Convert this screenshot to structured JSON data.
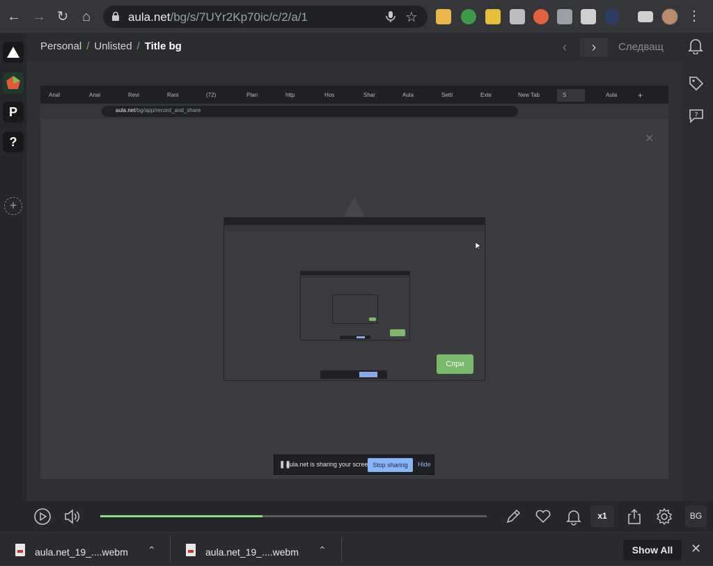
{
  "browser": {
    "url_host": "aula.net",
    "url_path": "/bg/s/7UYr2Kp70ic/c/2/a/1"
  },
  "header": {
    "breadcrumbs": [
      "Personal",
      "Unlisted",
      "Title bg"
    ],
    "next_label": "Следващ"
  },
  "left_rail": {
    "items": [
      "P",
      "?"
    ]
  },
  "video": {
    "tabs": [
      "Anal",
      "Anal",
      "Revi",
      "Rani",
      "(72)",
      "Plan",
      "http",
      "Hos",
      "Shar",
      "Aula",
      "Setti",
      "Exte",
      "New Tab",
      "S",
      "Aula"
    ],
    "inner_url_host": "aula.net",
    "inner_url_path": "/bg/app/record_and_share",
    "green_button_label": "Спри",
    "share_message": "aula.net is sharing your screen.",
    "stop_sharing": "Stop sharing",
    "hide": "Hide"
  },
  "player": {
    "progress": 0.42,
    "speed": "x1",
    "badge": "BG"
  },
  "downloads": {
    "items": [
      {
        "name": "aula.net_19_....webm"
      },
      {
        "name": "aula.net_19_....webm"
      }
    ],
    "show_all": "Show All"
  },
  "colors": {
    "accent_green": "#7ab86a",
    "progress_green": "#86e27a",
    "link_blue": "#8ab4f8"
  }
}
